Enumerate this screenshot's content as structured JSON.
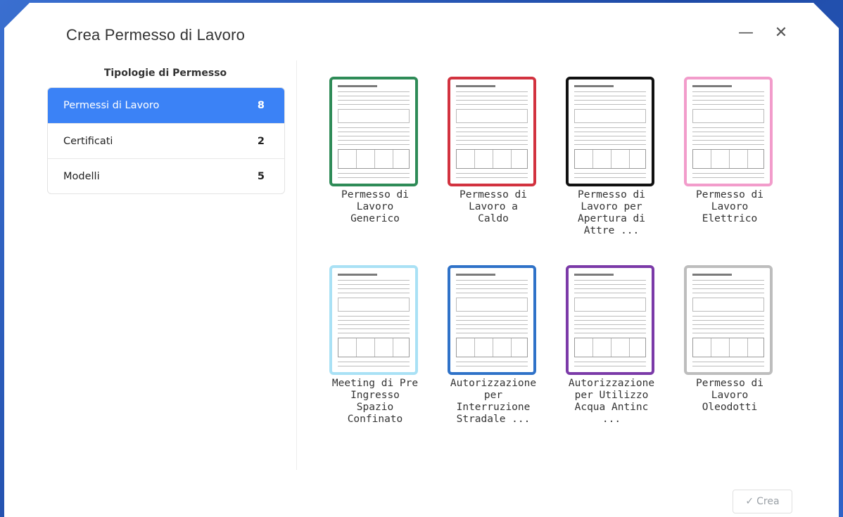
{
  "dialog": {
    "title": "Crea Permesso di Lavoro",
    "minimize_icon": "—",
    "close_icon": "✕"
  },
  "sidebar": {
    "title": "Tipologie di Permesso",
    "items": [
      {
        "label": "Permessi di Lavoro",
        "count": "8",
        "active": true
      },
      {
        "label": "Certificati",
        "count": "2",
        "active": false
      },
      {
        "label": "Modelli",
        "count": "5",
        "active": false
      }
    ]
  },
  "templates": [
    {
      "label": "Permesso di\nLavoro\nGenerico",
      "border": "#2e8b57"
    },
    {
      "label": "Permesso di\nLavoro a\nCaldo",
      "border": "#d2323f"
    },
    {
      "label": "Permesso di\nLavoro per\nApertura di\nAttre ...",
      "border": "#111111"
    },
    {
      "label": "Permesso di\nLavoro\nElettrico",
      "border": "#f29ccb"
    },
    {
      "label": "Meeting di Pre\nIngresso\nSpazio\nConfinato",
      "border": "#a9e1f5"
    },
    {
      "label": "Autorizzazione\nper\nInterruzione\nStradale ...",
      "border": "#2f72c8"
    },
    {
      "label": "Autorizzazione\nper Utilizzo\nAcqua Antinc\n...",
      "border": "#7b3aa8"
    },
    {
      "label": "Permesso di\nLavoro\nOleodotti",
      "border": "#bdbdbd"
    }
  ],
  "footer": {
    "crea_label": "Crea",
    "check_icon": "✓"
  }
}
